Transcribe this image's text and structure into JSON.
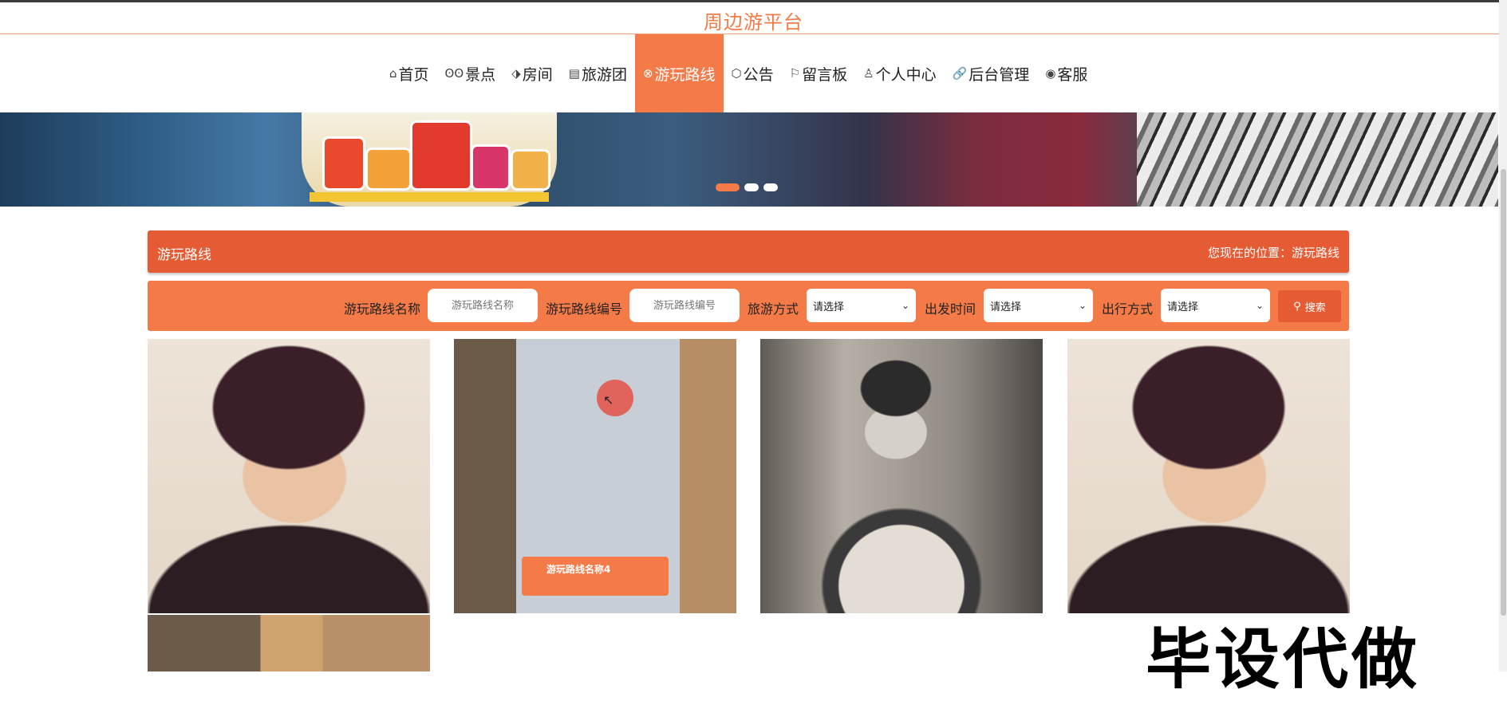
{
  "site": {
    "title": "周边游平台"
  },
  "nav": {
    "items": [
      {
        "label": "首页",
        "icon": "home-icon",
        "glyph": "⌂"
      },
      {
        "label": "景点",
        "icon": "binoculars-icon",
        "glyph": "ʘʘ"
      },
      {
        "label": "房间",
        "icon": "tag-icon",
        "glyph": "⬗"
      },
      {
        "label": "旅游团",
        "icon": "calendar-icon",
        "glyph": "▤"
      },
      {
        "label": "游玩路线",
        "icon": "route-icon",
        "glyph": "⊗",
        "active": true
      },
      {
        "label": "公告",
        "icon": "cube-icon",
        "glyph": "⬡"
      },
      {
        "label": "留言板",
        "icon": "flag-icon",
        "glyph": "⚐"
      },
      {
        "label": "个人中心",
        "icon": "user-icon",
        "glyph": "♙"
      },
      {
        "label": "后台管理",
        "icon": "link-icon",
        "glyph": "🔗"
      },
      {
        "label": "客服",
        "icon": "chat-icon",
        "glyph": "◉"
      }
    ]
  },
  "banner": {
    "slides": 3,
    "active_slide": 1
  },
  "breadcrumb": {
    "title": "游玩路线",
    "location": "您现在的位置：游玩路线"
  },
  "search": {
    "name_label": "游玩路线名称",
    "name_placeholder": "游玩路线名称",
    "code_label": "游玩路线编号",
    "code_placeholder": "游玩路线编号",
    "mode_label": "旅游方式",
    "mode_value": "请选择",
    "depart_label": "出发时间",
    "depart_value": "请选择",
    "travel_label": "出行方式",
    "travel_value": "请选择",
    "button_label": "搜索"
  },
  "cards": [
    {
      "caption": ""
    },
    {
      "caption": "游玩路线名称4"
    },
    {
      "caption": ""
    },
    {
      "caption": ""
    }
  ],
  "watermark": "毕设代做",
  "colors": {
    "accent": "#f47b47",
    "accent_dark": "#e45b34"
  }
}
